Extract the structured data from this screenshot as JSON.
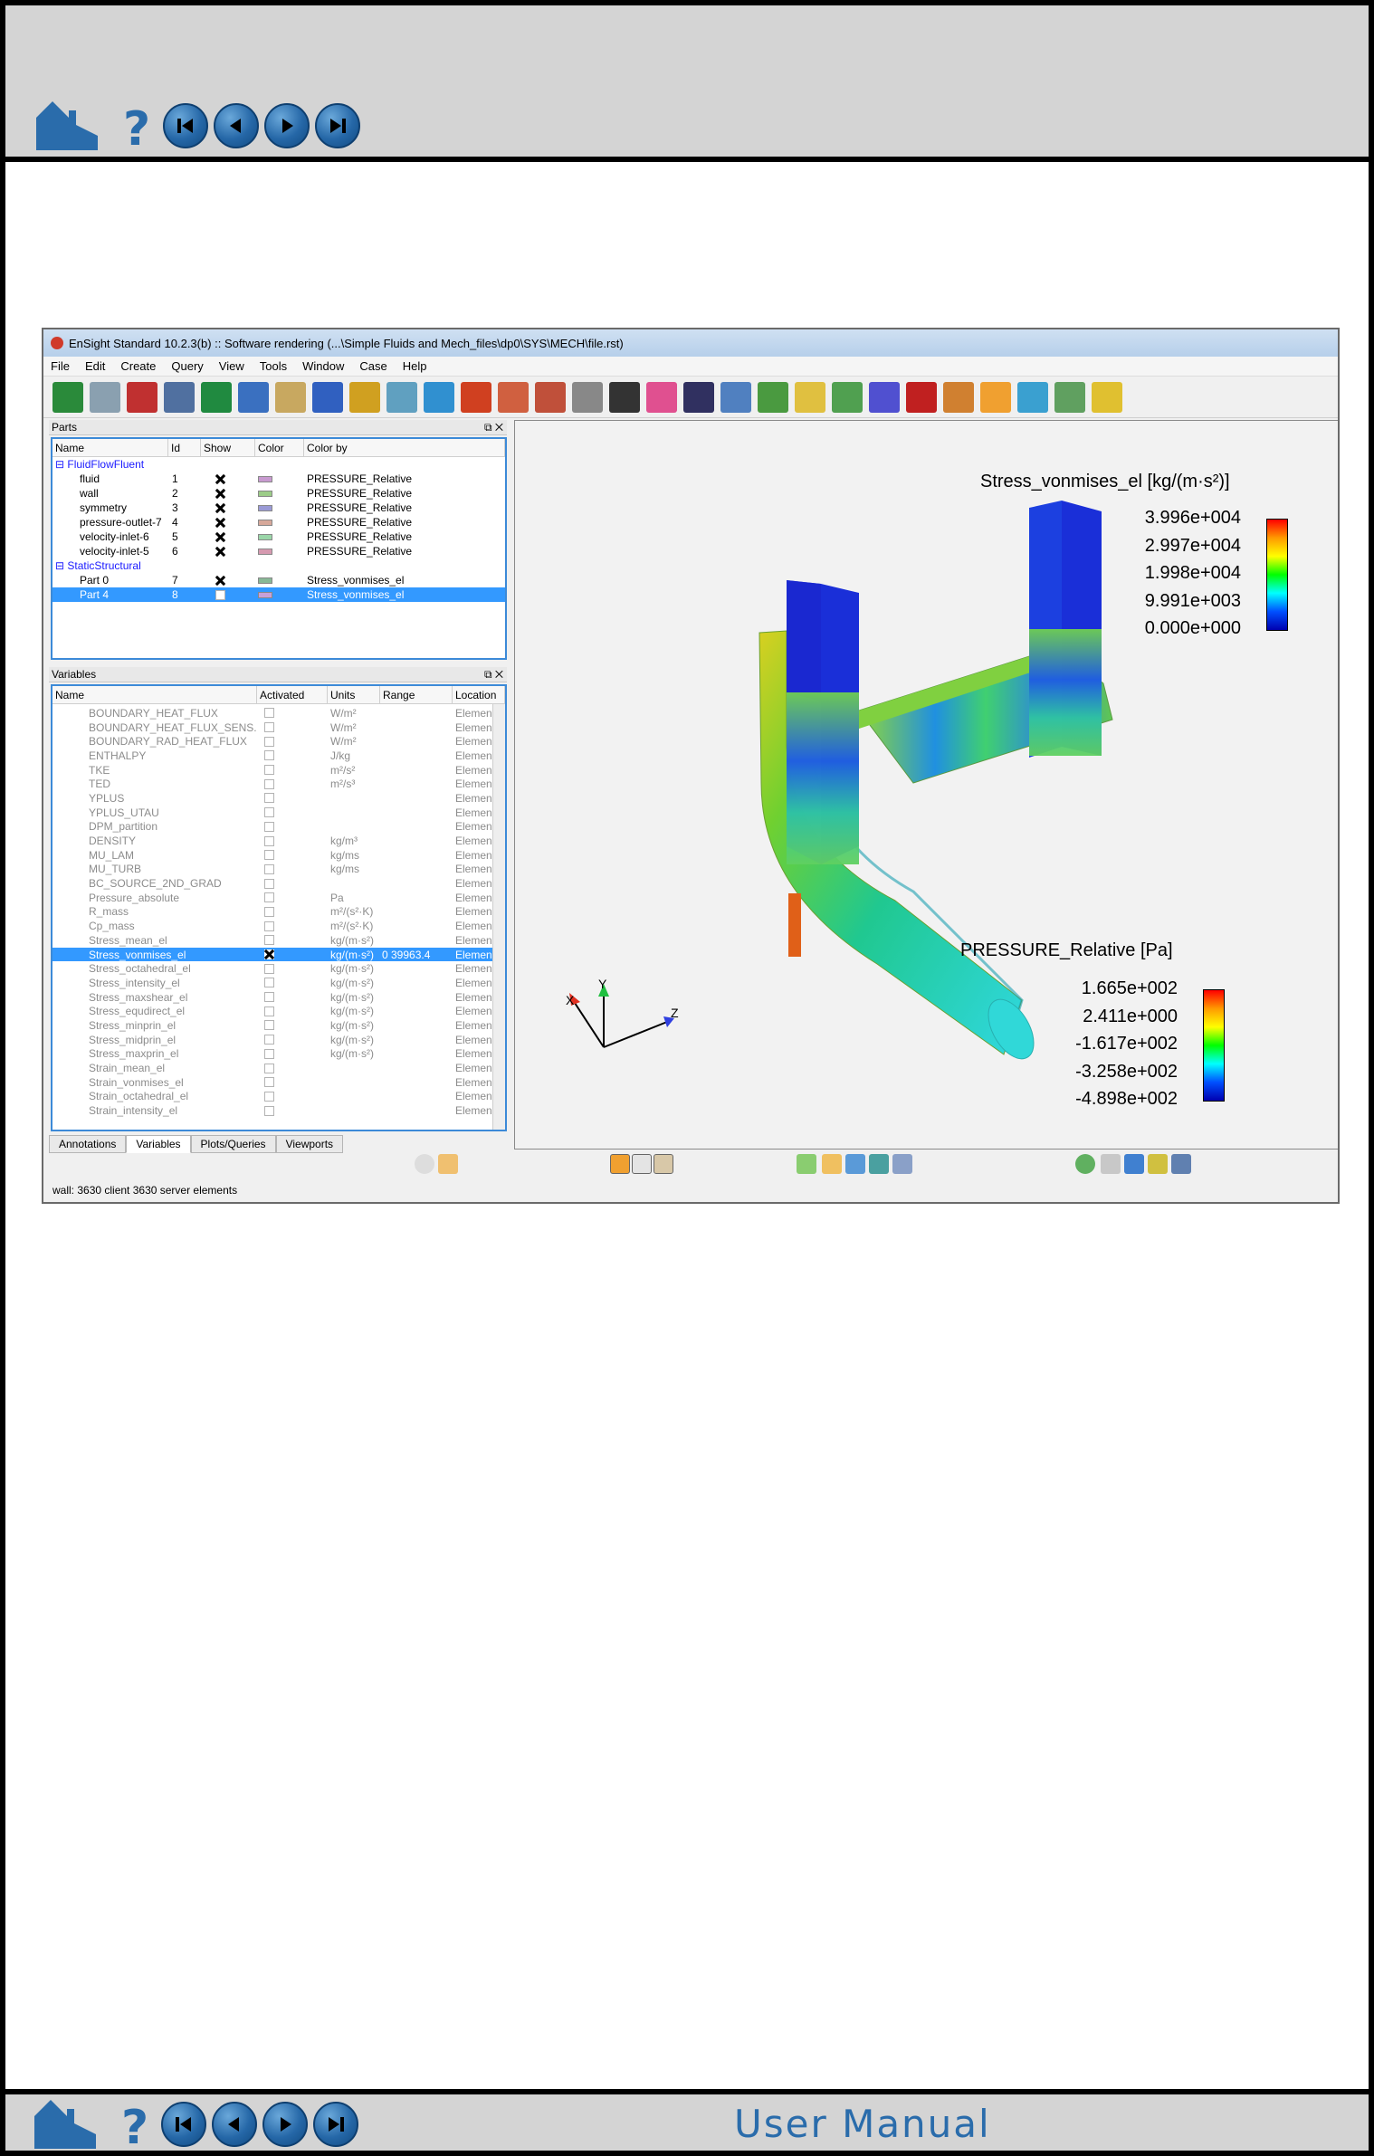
{
  "footer": {
    "brand": "User Manual"
  },
  "window": {
    "title": "EnSight Standard 10.2.3(b) :: Software rendering (...\\Simple Fluids and Mech_files\\dp0\\SYS\\MECH\\file.rst)",
    "menu": [
      "File",
      "Edit",
      "Create",
      "Query",
      "View",
      "Tools",
      "Window",
      "Case",
      "Help"
    ]
  },
  "parts": {
    "title": "Parts",
    "columns": [
      "Name",
      "Id",
      "Show",
      "Color",
      "Color by"
    ],
    "groups": [
      {
        "name": "FluidFlowFluent",
        "rows": [
          {
            "name": "fluid",
            "id": "1",
            "show": true,
            "color": "#c89ad0",
            "color_by": "PRESSURE_Relative"
          },
          {
            "name": "wall",
            "id": "2",
            "show": true,
            "color": "#9ccc88",
            "color_by": "PRESSURE_Relative"
          },
          {
            "name": "symmetry",
            "id": "3",
            "show": true,
            "color": "#9a9ad6",
            "color_by": "PRESSURE_Relative"
          },
          {
            "name": "pressure-outlet-7",
            "id": "4",
            "show": true,
            "color": "#d6a89a",
            "color_by": "PRESSURE_Relative"
          },
          {
            "name": "velocity-inlet-6",
            "id": "5",
            "show": true,
            "color": "#9ad6a8",
            "color_by": "PRESSURE_Relative"
          },
          {
            "name": "velocity-inlet-5",
            "id": "6",
            "show": true,
            "color": "#d69ab0",
            "color_by": "PRESSURE_Relative"
          }
        ]
      },
      {
        "name": "StaticStructural",
        "rows": [
          {
            "name": "Part 0",
            "id": "7",
            "show": true,
            "color": "#88b896",
            "color_by": "Stress_vonmises_el"
          },
          {
            "name": "Part 4",
            "id": "8",
            "show": false,
            "color": "#c8a0d8",
            "color_by": "Stress_vonmises_el",
            "selected": true
          }
        ]
      }
    ]
  },
  "variables": {
    "title": "Variables",
    "columns": [
      "Name",
      "Activated",
      "Units",
      "Range",
      "Location"
    ],
    "rows": [
      {
        "name": "BOUNDARY_HEAT_FLUX",
        "units": "W/m²",
        "range": "",
        "loc": "Elemen"
      },
      {
        "name": "BOUNDARY_HEAT_FLUX_SENS...",
        "units": "W/m²",
        "range": "",
        "loc": "Elemen"
      },
      {
        "name": "BOUNDARY_RAD_HEAT_FLUX",
        "units": "W/m²",
        "range": "",
        "loc": "Elemen"
      },
      {
        "name": "ENTHALPY",
        "units": "J/kg",
        "range": "",
        "loc": "Elemen"
      },
      {
        "name": "TKE",
        "units": "m²/s²",
        "range": "",
        "loc": "Elemen"
      },
      {
        "name": "TED",
        "units": "m²/s³",
        "range": "",
        "loc": "Elemen"
      },
      {
        "name": "YPLUS",
        "units": "",
        "range": "",
        "loc": "Elemen"
      },
      {
        "name": "YPLUS_UTAU",
        "units": "",
        "range": "",
        "loc": "Elemen"
      },
      {
        "name": "DPM_partition",
        "units": "",
        "range": "",
        "loc": "Elemen"
      },
      {
        "name": "DENSITY",
        "units": "kg/m³",
        "range": "",
        "loc": "Elemen"
      },
      {
        "name": "MU_LAM",
        "units": "kg/ms",
        "range": "",
        "loc": "Elemen"
      },
      {
        "name": "MU_TURB",
        "units": "kg/ms",
        "range": "",
        "loc": "Elemen"
      },
      {
        "name": "BC_SOURCE_2ND_GRAD",
        "units": "",
        "range": "",
        "loc": "Elemen"
      },
      {
        "name": "Pressure_absolute",
        "units": "Pa",
        "range": "",
        "loc": "Elemen"
      },
      {
        "name": "R_mass",
        "units": "m²/(s²·K)",
        "range": "",
        "loc": "Elemen"
      },
      {
        "name": "Cp_mass",
        "units": "m²/(s²·K)",
        "range": "",
        "loc": "Elemen"
      },
      {
        "name": "Stress_mean_el",
        "units": "kg/(m·s²)",
        "range": "",
        "loc": "Elemen"
      },
      {
        "name": "Stress_vonmises_el",
        "units": "kg/(m·s²)",
        "range": "0   39963.4",
        "loc": "Elemen",
        "active": true
      },
      {
        "name": "Stress_octahedral_el",
        "units": "kg/(m·s²)",
        "range": "",
        "loc": "Elemen"
      },
      {
        "name": "Stress_intensity_el",
        "units": "kg/(m·s²)",
        "range": "",
        "loc": "Elemen"
      },
      {
        "name": "Stress_maxshear_el",
        "units": "kg/(m·s²)",
        "range": "",
        "loc": "Elemen"
      },
      {
        "name": "Stress_equdirect_el",
        "units": "kg/(m·s²)",
        "range": "",
        "loc": "Elemen"
      },
      {
        "name": "Stress_minprin_el",
        "units": "kg/(m·s²)",
        "range": "",
        "loc": "Elemen"
      },
      {
        "name": "Stress_midprin_el",
        "units": "kg/(m·s²)",
        "range": "",
        "loc": "Elemen"
      },
      {
        "name": "Stress_maxprin_el",
        "units": "kg/(m·s²)",
        "range": "",
        "loc": "Elemen"
      },
      {
        "name": "Strain_mean_el",
        "units": "",
        "range": "",
        "loc": "Elemen"
      },
      {
        "name": "Strain_vonmises_el",
        "units": "",
        "range": "",
        "loc": "Elemen"
      },
      {
        "name": "Strain_octahedral_el",
        "units": "",
        "range": "",
        "loc": "Elemen"
      },
      {
        "name": "Strain_intensity_el",
        "units": "",
        "range": "",
        "loc": "Elemen"
      }
    ]
  },
  "tabs": [
    "Annotations",
    "Variables",
    "Plots/Queries",
    "Viewports"
  ],
  "active_tab": "Variables",
  "viewport": {
    "legend_stress": {
      "title": "Stress_vonmises_el [kg/(m·s²)]",
      "values": [
        "3.996e+004",
        "2.997e+004",
        "1.998e+004",
        "9.991e+003",
        "0.000e+000"
      ]
    },
    "legend_pressure": {
      "title": "PRESSURE_Relative [Pa]",
      "values": [
        "1.665e+002",
        "2.411e+000",
        "-1.617e+002",
        "-3.258e+002",
        "-4.898e+002"
      ]
    },
    "axes": {
      "x": "X",
      "y": "Y",
      "z": "Z"
    }
  },
  "status": "wall: 3630 client 3630 server elements",
  "colors": {
    "selection": "#3399ff",
    "group": "#1a1aff",
    "nav": "#2567a7"
  }
}
